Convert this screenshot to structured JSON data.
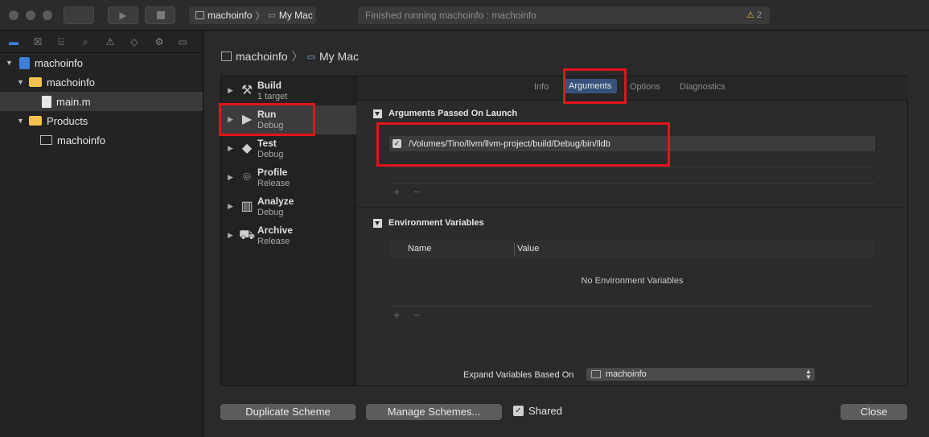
{
  "toolbar": {
    "scheme": "machoinfo",
    "destination": "My Mac",
    "status": "Finished running machoinfo : machoinfo",
    "warning_count": "2"
  },
  "navigator": {
    "items": [
      {
        "label": "machoinfo",
        "type": "project"
      },
      {
        "label": "machoinfo",
        "type": "folder"
      },
      {
        "label": "main.m",
        "type": "file"
      },
      {
        "label": "Products",
        "type": "folder"
      },
      {
        "label": "machoinfo",
        "type": "executable"
      }
    ]
  },
  "sheet": {
    "breadcrumb": {
      "scheme": "machoinfo",
      "destination": "My Mac"
    },
    "actions": [
      {
        "title": "Build",
        "subtitle": "1 target",
        "icon": "hammer-icon"
      },
      {
        "title": "Run",
        "subtitle": "Debug",
        "icon": "play-icon"
      },
      {
        "title": "Test",
        "subtitle": "Debug",
        "icon": "test-icon"
      },
      {
        "title": "Profile",
        "subtitle": "Release",
        "icon": "gauge-icon"
      },
      {
        "title": "Analyze",
        "subtitle": "Debug",
        "icon": "analyze-icon"
      },
      {
        "title": "Archive",
        "subtitle": "Release",
        "icon": "archive-icon"
      }
    ],
    "tabs": [
      "Info",
      "Arguments",
      "Options",
      "Diagnostics"
    ],
    "selected_tab": "Arguments",
    "arguments": {
      "header": "Arguments Passed On Launch",
      "items": [
        {
          "checked": true,
          "value": "/Volumes/Tino/llvm/llvm-project/build/Debug/bin/lldb"
        }
      ]
    },
    "environment": {
      "header": "Environment Variables",
      "columns": [
        "Name",
        "Value"
      ],
      "empty_text": "No Environment Variables"
    },
    "expand": {
      "label": "Expand Variables Based On",
      "value": "machoinfo"
    },
    "buttons": {
      "duplicate": "Duplicate Scheme",
      "manage": "Manage Schemes...",
      "shared": "Shared",
      "close": "Close"
    }
  },
  "colors": {
    "highlight": "#e3141b",
    "selected_tab": "#37527a",
    "folder": "#f2c14e"
  }
}
